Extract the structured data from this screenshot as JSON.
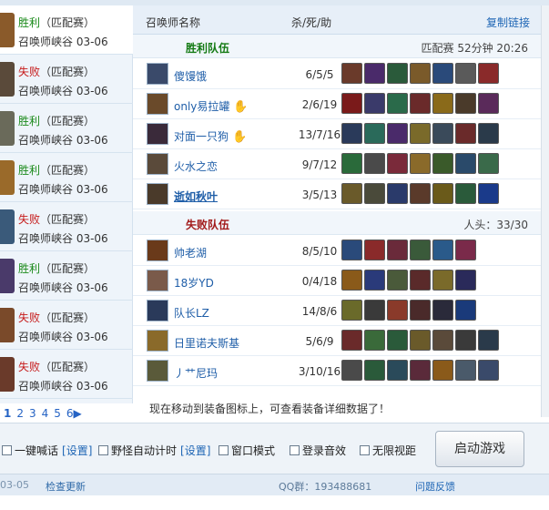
{
  "history": {
    "items": [
      {
        "result": "胜利",
        "mode": "（匹配赛）",
        "map_date": "召唤师峡谷 03-06",
        "outcome": "win",
        "avatar_color": "#8a5a2a"
      },
      {
        "result": "失败",
        "mode": "（匹配赛）",
        "map_date": "召唤师峡谷 03-06",
        "outcome": "loss",
        "avatar_color": "#5a4a3a"
      },
      {
        "result": "胜利",
        "mode": "（匹配赛）",
        "map_date": "召唤师峡谷 03-06",
        "outcome": "win",
        "avatar_color": "#6a6a5a"
      },
      {
        "result": "胜利",
        "mode": "（匹配赛）",
        "map_date": "召唤师峡谷 03-06",
        "outcome": "win",
        "avatar_color": "#9a6a2a"
      },
      {
        "result": "失败",
        "mode": "（匹配赛）",
        "map_date": "召唤师峡谷 03-06",
        "outcome": "loss",
        "avatar_color": "#3a5a7a"
      },
      {
        "result": "胜利",
        "mode": "（匹配赛）",
        "map_date": "召唤师峡谷 03-06",
        "outcome": "win",
        "avatar_color": "#4a3a6a"
      },
      {
        "result": "失败",
        "mode": "（匹配赛）",
        "map_date": "召唤师峡谷 03-06",
        "outcome": "loss",
        "avatar_color": "#7a4a2a"
      },
      {
        "result": "失败",
        "mode": "（匹配赛）",
        "map_date": "召唤师峡谷 03-06",
        "outcome": "loss",
        "avatar_color": "#6a3a2a"
      }
    ],
    "pages": [
      "1",
      "2",
      "3",
      "4",
      "5",
      "6▶"
    ]
  },
  "header": {
    "col_name": "召唤师名称",
    "col_kda": "杀/死/助",
    "copy_link": "复制链接"
  },
  "win_team": {
    "name": "胜利队伍",
    "info": "匹配赛 52分钟 20:26",
    "players": [
      {
        "name": "傻馒饿",
        "kda": "6/5/5",
        "hand": "",
        "bold": false,
        "avatar": "#3a4a6a",
        "items": [
          "#6a3a2a",
          "#4a2a6a",
          "#2a5a3a",
          "#7a5a2a",
          "#2a4a7a",
          "#5a5a5a",
          "#8a2a2a"
        ]
      },
      {
        "name": "only易拉罐",
        "kda": "2/6/19",
        "hand": "✋",
        "bold": false,
        "avatar": "#6a4a2a",
        "items": [
          "#7a1a1a",
          "#3a3a6a",
          "#2a6a4a",
          "#6a2a2a",
          "#8a6a1a",
          "#4a3a2a",
          "#5a2a5a"
        ]
      },
      {
        "name": "对面一只狗",
        "kda": "13/7/16",
        "hand": "✋",
        "bold": false,
        "avatar": "#3a2a3a",
        "items": [
          "#2a3a5a",
          "#2a6a5a",
          "#4a2a6a",
          "#7a6a2a",
          "#3a4a5a",
          "#6a2a2a",
          "#2a3a4a"
        ]
      },
      {
        "name": "火水之恋",
        "kda": "9/7/12",
        "hand": "",
        "bold": false,
        "avatar": "#5a4a3a",
        "items": [
          "#2a6a3a",
          "#4a4a4a",
          "#7a2a3a",
          "#8a6a2a",
          "#3a5a2a",
          "#2a4a6a",
          "#3a6a4a"
        ]
      },
      {
        "name": "逝如秋叶",
        "kda": "3/5/13",
        "hand": "",
        "bold": true,
        "avatar": "#4a3a2a",
        "items": [
          "#6a5a2a",
          "#4a4a3a",
          "#2a3a6a",
          "#5a3a2a",
          "#6a5a1a",
          "#2a5a3a",
          "#1a3a8a"
        ]
      }
    ]
  },
  "loss_team": {
    "name": "失败队伍",
    "info": "人头：33/30",
    "players": [
      {
        "name": "帅老湖",
        "kda": "8/5/10",
        "hand": "",
        "bold": false,
        "avatar": "#6a3a1a",
        "items": [
          "#2a4a7a",
          "#8a2a2a",
          "#6a2a3a",
          "#3a5a3a",
          "#2a5a8a",
          "#7a2a4a"
        ]
      },
      {
        "name": "18岁YD",
        "kda": "0/4/18",
        "hand": "",
        "bold": false,
        "avatar": "#7a5a4a",
        "items": [
          "#8a5a1a",
          "#2a3a7a",
          "#4a5a3a",
          "#5a2a2a",
          "#7a6a2a",
          "#2a2a5a"
        ]
      },
      {
        "name": "队长LZ",
        "kda": "14/8/6",
        "hand": "",
        "bold": false,
        "avatar": "#2a3a5a",
        "items": [
          "#6a6a2a",
          "#3a3a3a",
          "#8a3a2a",
          "#4a2a2a",
          "#2a2a3a",
          "#1a3a7a"
        ]
      },
      {
        "name": "日里诺夫斯基",
        "kda": "5/6/9",
        "hand": "",
        "bold": false,
        "avatar": "#8a6a2a",
        "items": [
          "#6a2a2a",
          "#3a6a3a",
          "#2a5a3a",
          "#6a5a2a",
          "#5a4a3a",
          "#3a3a3a",
          "#2a3a4a"
        ]
      },
      {
        "name": "丿艹尼玛",
        "kda": "3/10/16",
        "hand": "",
        "bold": false,
        "avatar": "#5a5a3a",
        "items": [
          "#4a4a4a",
          "#2a5a3a",
          "#2a4a5a",
          "#5a2a3a",
          "#8a5a1a",
          "#4a5a6a",
          "#3a4a6a"
        ]
      }
    ]
  },
  "notice": "现在移动到装备图标上，可查看装备详细数据了！",
  "options": {
    "auto_shout": "一键喊话",
    "set1": "[设置]",
    "jungle_timer": "野怪自动计时",
    "set2": "[设置]",
    "window_mode": "窗口模式",
    "login_sound": "登录音效",
    "unlimited_view": "无限视距",
    "launch": "启动游戏"
  },
  "footer": {
    "date": "03-05",
    "check_update": "检查更新",
    "qq": "QQ群：193488681",
    "feedback": "问题反馈"
  },
  "colors": {
    "win": "#1a8a1a",
    "loss": "#c61b1b",
    "link": "#1f66b5"
  }
}
